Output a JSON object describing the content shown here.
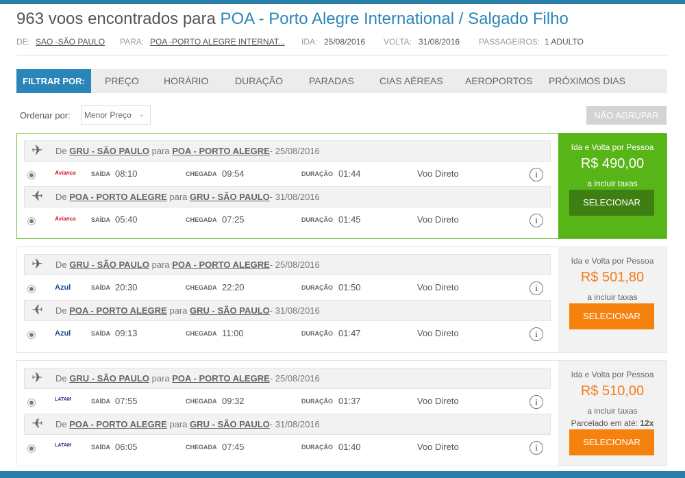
{
  "header": {
    "title_prefix": "963 voos encontrados para ",
    "title_dest": "POA - Porto Alegre International / Salgado Filho"
  },
  "summary": {
    "from_label": "DE:",
    "from_value": "SAO -SÃO PAULO",
    "to_label": "PARA:",
    "to_value": "POA -PORTO ALEGRE INTERNAT...",
    "depart_label": "IDA:",
    "depart_value": "25/08/2016",
    "return_label": "VOLTA:",
    "return_value": "31/08/2016",
    "pax_label": "PASSAGEIROS:",
    "pax_value": "1 ADULTO"
  },
  "filters": {
    "head": "FILTRAR POR:",
    "tabs": [
      "PREÇO",
      "HORÁRIO",
      "DURAÇÃO",
      "PARADAS",
      "CIAS AÉREAS",
      "AEROPORTOS",
      "PRÓXIMOS DIAS"
    ]
  },
  "sort": {
    "label": "Ordenar por:",
    "value": "Menor Preço",
    "no_group": "NÃO AGRUPAR"
  },
  "labels": {
    "de": "De ",
    "para": " para ",
    "saida": "SAÍDA",
    "chegada": "CHEGADA",
    "duracao": "DURAÇÃO",
    "info": "i"
  },
  "results": [
    {
      "legs": [
        {
          "from": "GRU - SÃO PAULO",
          "to": "POA - PORTO ALEGRE",
          "date": "- 25/08/2016",
          "airline": "Avianca",
          "dep": "08:10",
          "arr": "09:54",
          "dur": "01:44",
          "type": "Voo Direto"
        },
        {
          "from": "POA - PORTO ALEGRE",
          "to": "GRU - SÃO PAULO",
          "date": "- 31/08/2016",
          "airline": "Avianca",
          "dep": "05:40",
          "arr": "07:25",
          "dur": "01:45",
          "type": "Voo Direto"
        }
      ],
      "price_label": "Ida e Volta por Pessoa",
      "price": "R$ 490,00",
      "taxes": "a incluir taxas",
      "select": "SELECIONAR"
    },
    {
      "legs": [
        {
          "from": "GRU - SÃO PAULO",
          "to": "POA - PORTO ALEGRE",
          "date": "- 25/08/2016",
          "airline": "Azul",
          "dep": "20:30",
          "arr": "22:20",
          "dur": "01:50",
          "type": "Voo Direto"
        },
        {
          "from": "POA - PORTO ALEGRE",
          "to": "GRU - SÃO PAULO",
          "date": "- 31/08/2016",
          "airline": "Azul",
          "dep": "09:13",
          "arr": "11:00",
          "dur": "01:47",
          "type": "Voo Direto"
        }
      ],
      "price_label": "Ida e Volta por Pessoa",
      "price": "R$ 501,80",
      "taxes": "a incluir taxas",
      "select": "SELECIONAR"
    },
    {
      "legs": [
        {
          "from": "GRU - SÃO PAULO",
          "to": "POA - PORTO ALEGRE",
          "date": "- 25/08/2016",
          "airline": "LATAM",
          "dep": "07:55",
          "arr": "09:32",
          "dur": "01:37",
          "type": "Voo Direto"
        },
        {
          "from": "POA - PORTO ALEGRE",
          "to": "GRU - SÃO PAULO",
          "date": "- 31/08/2016",
          "airline": "LATAM",
          "dep": "06:05",
          "arr": "07:45",
          "dur": "01:40",
          "type": "Voo Direto"
        }
      ],
      "price_label": "Ida e Volta por Pessoa",
      "price": "R$ 510,00",
      "taxes": "a incluir taxas",
      "parcel_text": "Parcelado em até: ",
      "parcel_value": "12x",
      "select": "SELECIONAR"
    }
  ],
  "icons": {
    "plane_out": "airplane-icon",
    "plane_back": "airplane-icon",
    "info": "info-icon",
    "chevron": "chevron-down-icon"
  },
  "colors": {
    "accent": "#2a86b8",
    "best": "#58b517",
    "select": "#f5820f",
    "price": "#f27c1a"
  }
}
